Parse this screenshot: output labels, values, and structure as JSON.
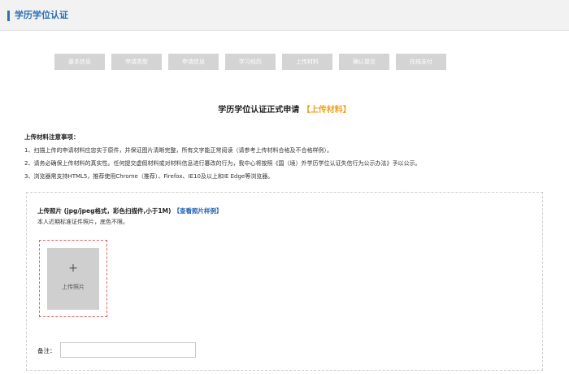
{
  "header": {
    "title": "学历学位认证"
  },
  "steps": [
    {
      "label": "基本信息"
    },
    {
      "label": "申请类型"
    },
    {
      "label": "申请信息"
    },
    {
      "label": "学习经历"
    },
    {
      "label": "上传材料"
    },
    {
      "label": "确认提交"
    },
    {
      "label": "在线支付"
    }
  ],
  "heading": {
    "main": "学历学位认证正式申请",
    "highlight": "【上传材料】",
    "highlight_color": "#f0a020"
  },
  "notes": {
    "title": "上传材料注意事项：",
    "items": [
      "1、扫描上传的申请材料应忠实于原件，并保证图片清晰完整，所有文字能正常阅读（请参考上传材料合格及不合格样例）。",
      "2、请务必确保上传材料的真实性。任何提交虚假材料或对材料信息进行篡改的行为，我中心将按照《国（境）外学历学位认证失信行为公示办法》予以公示。",
      "3、浏览器需支持HTML5，推荐使用Chrome（推荐）、Firefox、IE10及以上和IE Edge等浏览器。"
    ]
  },
  "photo": {
    "label": "上传照片 (jpg/jpeg格式，彩色扫描件,小于1M)",
    "link": "【查看照片样例】",
    "desc": "本人近期标准证件照片，底色不限。",
    "plus": "+",
    "slot_label": "上传照片"
  },
  "remark": {
    "label": "备注：",
    "value": ""
  },
  "colors": {
    "accent": "#2f6fb5",
    "step_bg": "#d4d4d4",
    "link": "#1f5fb0"
  }
}
